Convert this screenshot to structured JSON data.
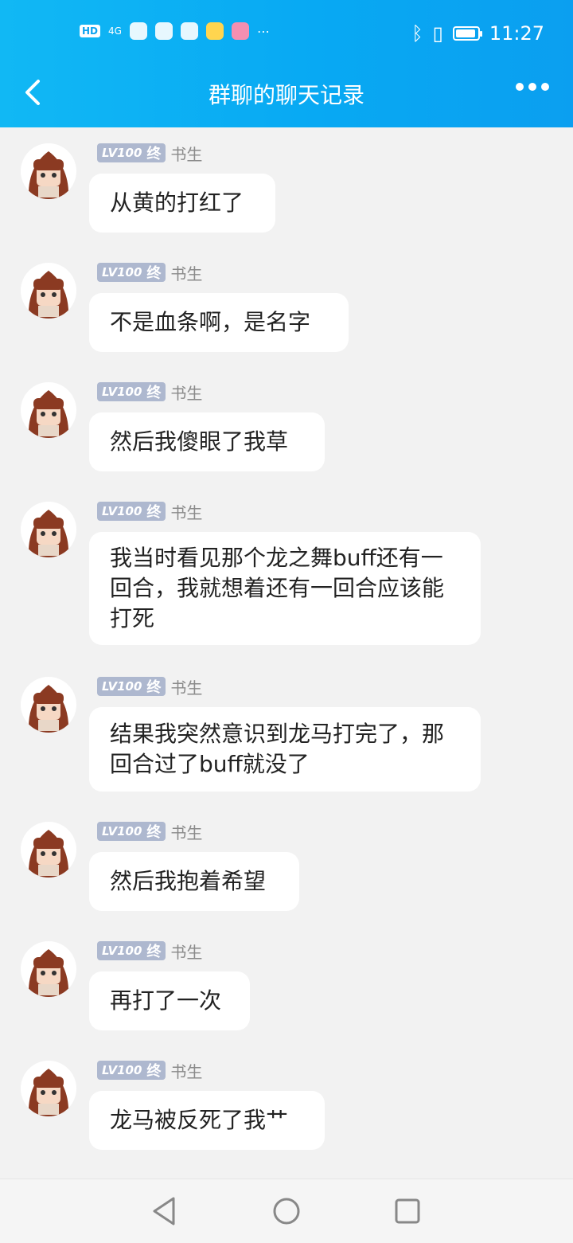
{
  "status": {
    "hd": "HD",
    "signal": "4G",
    "time": "11:27"
  },
  "header": {
    "title": "群聊的聊天记录",
    "back_icon": "chevron-left-icon",
    "more_icon": "more-icon"
  },
  "messages": [
    {
      "level": "LV100",
      "rank": "终",
      "name": "书生",
      "text": "从黄的打红了"
    },
    {
      "level": "LV100",
      "rank": "终",
      "name": "书生",
      "text": "不是血条啊，是名字"
    },
    {
      "level": "LV100",
      "rank": "终",
      "name": "书生",
      "text": "然后我傻眼了我草"
    },
    {
      "level": "LV100",
      "rank": "终",
      "name": "书生",
      "text": "我当时看见那个龙之舞buff还有一回合，我就想着还有一回合应该能打死"
    },
    {
      "level": "LV100",
      "rank": "终",
      "name": "书生",
      "text": "结果我突然意识到龙马打完了，那回合过了buff就没了"
    },
    {
      "level": "LV100",
      "rank": "终",
      "name": "书生",
      "text": "然后我抱着希望"
    },
    {
      "level": "LV100",
      "rank": "终",
      "name": "书生",
      "text": "再打了一次"
    },
    {
      "level": "LV100",
      "rank": "终",
      "name": "书生",
      "text": "龙马被反死了我艹"
    }
  ],
  "colors": {
    "accent": "#0ea3ef",
    "badge": "#aeb8cf"
  }
}
